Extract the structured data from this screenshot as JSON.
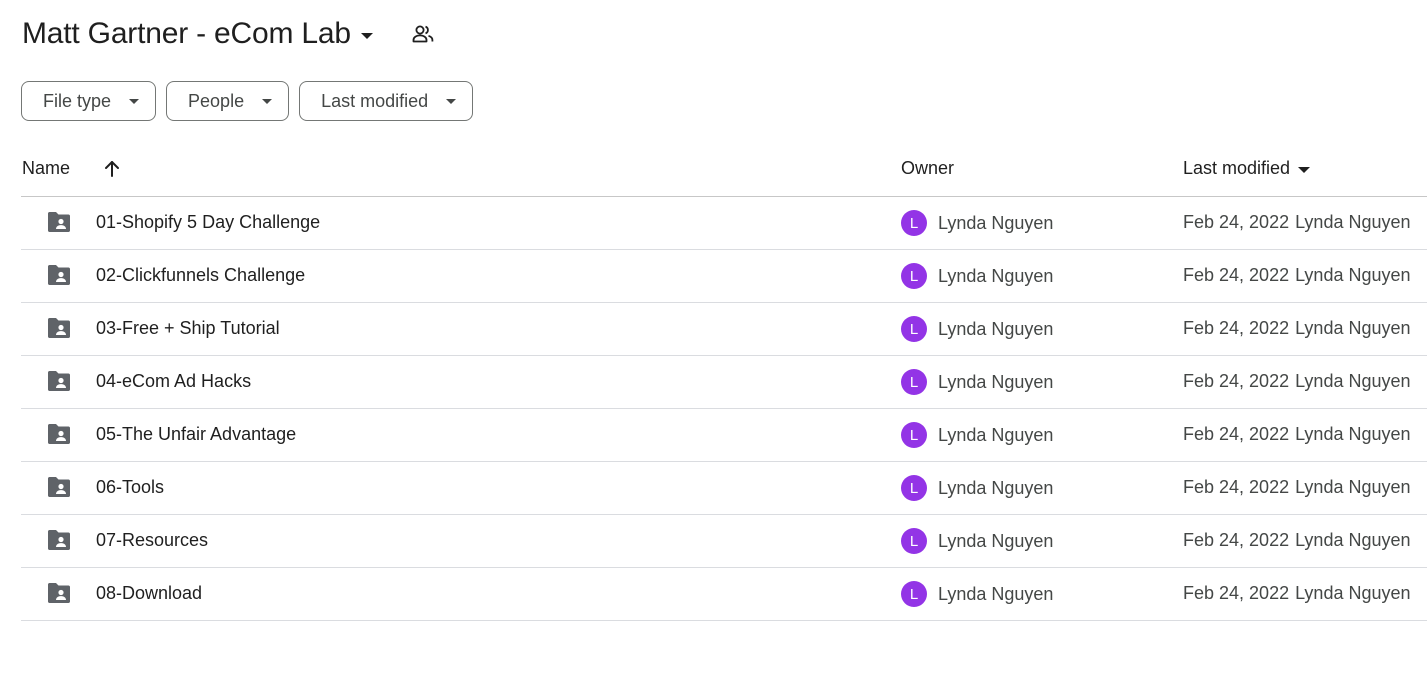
{
  "header": {
    "title": "Matt Gartner - eCom Lab",
    "title_menu_icon": "caret-down-icon",
    "shared_icon": "shared-people-icon"
  },
  "filters": [
    {
      "label": "File type"
    },
    {
      "label": "People"
    },
    {
      "label": "Last modified"
    }
  ],
  "table": {
    "columns": {
      "name": "Name",
      "owner": "Owner",
      "last_modified": "Last modified"
    },
    "sort_icon": "arrow-up-icon",
    "rows": [
      {
        "name": "01-Shopify 5 Day Challenge",
        "owner_initial": "L",
        "owner": "Lynda Nguyen",
        "date": "Feb 24, 2022",
        "modified_by": "Lynda Nguyen"
      },
      {
        "name": "02-Clickfunnels Challenge",
        "owner_initial": "L",
        "owner": "Lynda Nguyen",
        "date": "Feb 24, 2022",
        "modified_by": "Lynda Nguyen"
      },
      {
        "name": "03-Free + Ship Tutorial",
        "owner_initial": "L",
        "owner": "Lynda Nguyen",
        "date": "Feb 24, 2022",
        "modified_by": "Lynda Nguyen"
      },
      {
        "name": "04-eCom Ad Hacks",
        "owner_initial": "L",
        "owner": "Lynda Nguyen",
        "date": "Feb 24, 2022",
        "modified_by": "Lynda Nguyen"
      },
      {
        "name": "05-The Unfair Advantage",
        "owner_initial": "L",
        "owner": "Lynda Nguyen",
        "date": "Feb 24, 2022",
        "modified_by": "Lynda Nguyen"
      },
      {
        "name": "06-Tools",
        "owner_initial": "L",
        "owner": "Lynda Nguyen",
        "date": "Feb 24, 2022",
        "modified_by": "Lynda Nguyen"
      },
      {
        "name": "07-Resources",
        "owner_initial": "L",
        "owner": "Lynda Nguyen",
        "date": "Feb 24, 2022",
        "modified_by": "Lynda Nguyen"
      },
      {
        "name": "08-Download",
        "owner_initial": "L",
        "owner": "Lynda Nguyen",
        "date": "Feb 24, 2022",
        "modified_by": "Lynda Nguyen"
      }
    ]
  },
  "colors": {
    "avatar": "#9334e6",
    "folder_icon": "#5f6368",
    "text_primary": "#1f1f1f",
    "text_secondary": "#444746"
  }
}
